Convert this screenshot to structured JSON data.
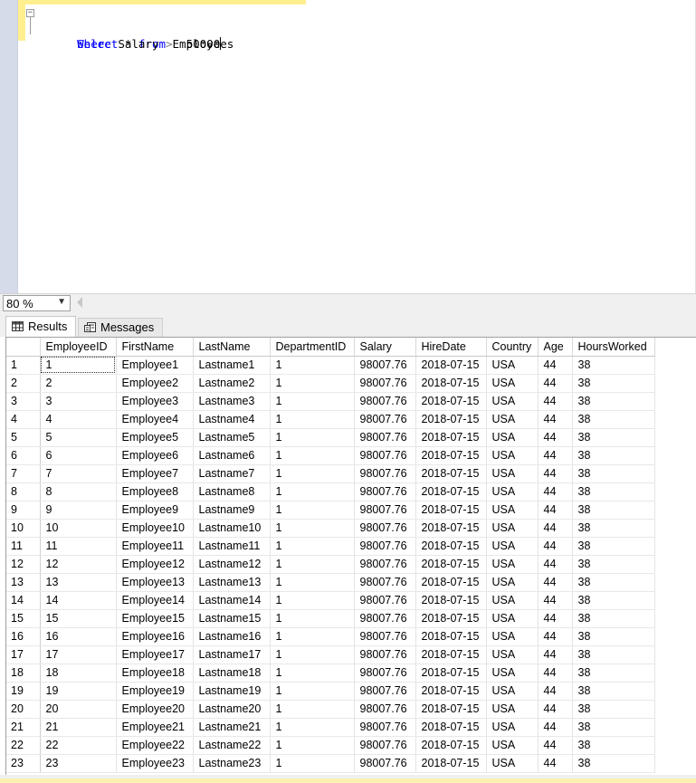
{
  "editor": {
    "line1": {
      "kw1": "Select",
      "rest": " * ",
      "kw2": "from",
      "tail": " Employees"
    },
    "line2": {
      "kw1": "Where",
      "middle": " Salary ",
      "op": ">",
      "value": "  50000"
    }
  },
  "zoom": {
    "value": "80 %"
  },
  "tabs": {
    "results": "Results",
    "messages": "Messages"
  },
  "grid": {
    "columns": [
      "EmployeeID",
      "FirstName",
      "LastName",
      "DepartmentID",
      "Salary",
      "HireDate",
      "Country",
      "Age",
      "HoursWorked"
    ],
    "rows": [
      [
        "1",
        "1",
        "Employee1",
        "Lastname1",
        "1",
        "98007.76",
        "2018-07-15",
        "USA",
        "44",
        "38"
      ],
      [
        "2",
        "2",
        "Employee2",
        "Lastname2",
        "1",
        "98007.76",
        "2018-07-15",
        "USA",
        "44",
        "38"
      ],
      [
        "3",
        "3",
        "Employee3",
        "Lastname3",
        "1",
        "98007.76",
        "2018-07-15",
        "USA",
        "44",
        "38"
      ],
      [
        "4",
        "4",
        "Employee4",
        "Lastname4",
        "1",
        "98007.76",
        "2018-07-15",
        "USA",
        "44",
        "38"
      ],
      [
        "5",
        "5",
        "Employee5",
        "Lastname5",
        "1",
        "98007.76",
        "2018-07-15",
        "USA",
        "44",
        "38"
      ],
      [
        "6",
        "6",
        "Employee6",
        "Lastname6",
        "1",
        "98007.76",
        "2018-07-15",
        "USA",
        "44",
        "38"
      ],
      [
        "7",
        "7",
        "Employee7",
        "Lastname7",
        "1",
        "98007.76",
        "2018-07-15",
        "USA",
        "44",
        "38"
      ],
      [
        "8",
        "8",
        "Employee8",
        "Lastname8",
        "1",
        "98007.76",
        "2018-07-15",
        "USA",
        "44",
        "38"
      ],
      [
        "9",
        "9",
        "Employee9",
        "Lastname9",
        "1",
        "98007.76",
        "2018-07-15",
        "USA",
        "44",
        "38"
      ],
      [
        "10",
        "10",
        "Employee10",
        "Lastname10",
        "1",
        "98007.76",
        "2018-07-15",
        "USA",
        "44",
        "38"
      ],
      [
        "11",
        "11",
        "Employee11",
        "Lastname11",
        "1",
        "98007.76",
        "2018-07-15",
        "USA",
        "44",
        "38"
      ],
      [
        "12",
        "12",
        "Employee12",
        "Lastname12",
        "1",
        "98007.76",
        "2018-07-15",
        "USA",
        "44",
        "38"
      ],
      [
        "13",
        "13",
        "Employee13",
        "Lastname13",
        "1",
        "98007.76",
        "2018-07-15",
        "USA",
        "44",
        "38"
      ],
      [
        "14",
        "14",
        "Employee14",
        "Lastname14",
        "1",
        "98007.76",
        "2018-07-15",
        "USA",
        "44",
        "38"
      ],
      [
        "15",
        "15",
        "Employee15",
        "Lastname15",
        "1",
        "98007.76",
        "2018-07-15",
        "USA",
        "44",
        "38"
      ],
      [
        "16",
        "16",
        "Employee16",
        "Lastname16",
        "1",
        "98007.76",
        "2018-07-15",
        "USA",
        "44",
        "38"
      ],
      [
        "17",
        "17",
        "Employee17",
        "Lastname17",
        "1",
        "98007.76",
        "2018-07-15",
        "USA",
        "44",
        "38"
      ],
      [
        "18",
        "18",
        "Employee18",
        "Lastname18",
        "1",
        "98007.76",
        "2018-07-15",
        "USA",
        "44",
        "38"
      ],
      [
        "19",
        "19",
        "Employee19",
        "Lastname19",
        "1",
        "98007.76",
        "2018-07-15",
        "USA",
        "44",
        "38"
      ],
      [
        "20",
        "20",
        "Employee20",
        "Lastname20",
        "1",
        "98007.76",
        "2018-07-15",
        "USA",
        "44",
        "38"
      ],
      [
        "21",
        "21",
        "Employee21",
        "Lastname21",
        "1",
        "98007.76",
        "2018-07-15",
        "USA",
        "44",
        "38"
      ],
      [
        "22",
        "22",
        "Employee22",
        "Lastname22",
        "1",
        "98007.76",
        "2018-07-15",
        "USA",
        "44",
        "38"
      ],
      [
        "23",
        "23",
        "Employee23",
        "Lastname23",
        "1",
        "98007.76",
        "2018-07-15",
        "USA",
        "44",
        "38"
      ]
    ]
  },
  "icons": {
    "results": "grid-icon",
    "messages": "messages-icon",
    "collapse": "collapse-minus-icon",
    "dropdown": "chevron-down-icon"
  }
}
